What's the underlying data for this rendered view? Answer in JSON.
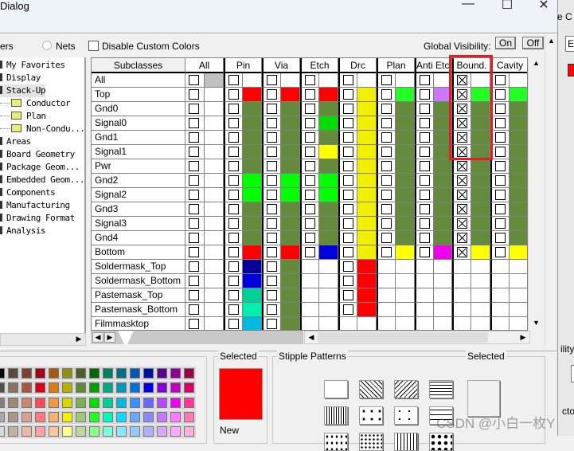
{
  "window": {
    "title": "Dialog",
    "minimize_icon": "minimize-icon",
    "maximize_icon": "maximize-icon",
    "close_icon": "close-icon"
  },
  "toolbar": {
    "layers_partial": "ers",
    "nets_label": "Nets",
    "disable_custom_colors_label": "Disable Custom Colors",
    "global_visibility_label": "Global Visibility:",
    "on_label": "On",
    "off_label": "Off"
  },
  "tree": {
    "items": [
      {
        "label": "My Favorites",
        "indent": 0
      },
      {
        "label": "Display",
        "indent": 0
      },
      {
        "label": "Stack-Up",
        "indent": 0,
        "selected": true
      },
      {
        "label": "Conductor",
        "indent": 1
      },
      {
        "label": "Plan",
        "indent": 1
      },
      {
        "label": "Non-Condu...",
        "indent": 1
      },
      {
        "label": "Areas",
        "indent": 0
      },
      {
        "label": "Board Geometry",
        "indent": 0
      },
      {
        "label": "Package Geom...",
        "indent": 0
      },
      {
        "label": "Embedded Geom...",
        "indent": 0
      },
      {
        "label": "Components",
        "indent": 0
      },
      {
        "label": "Manufacturing",
        "indent": 0
      },
      {
        "label": "Drawing Format",
        "indent": 0
      },
      {
        "label": "Analysis",
        "indent": 0
      }
    ]
  },
  "grid": {
    "subclasses_header": "Subclasses",
    "columns": [
      "All",
      "Pin",
      "Via",
      "Etch",
      "Drc",
      "Plan",
      "Anti Etch",
      "Bound.",
      "Cavity"
    ],
    "rows": [
      {
        "name": "All",
        "colors": [
          "#c0c0c0",
          null,
          null,
          null,
          null,
          null,
          null,
          null,
          null
        ],
        "checked": [
          false,
          false,
          false,
          false,
          false,
          false,
          false,
          true,
          false
        ]
      },
      {
        "name": "Top",
        "colors": [
          null,
          "#ff0000",
          "#ff0000",
          "#ff0000",
          "#f0f000",
          "#22ff22",
          "#cc77ff",
          "#22ff22",
          "#22ff22"
        ],
        "checked": [
          false,
          false,
          false,
          false,
          false,
          false,
          false,
          true,
          false
        ]
      },
      {
        "name": "Gnd0",
        "colors": [
          null,
          "#648a3c",
          "#648a3c",
          "#648a3c",
          "#f0f000",
          "#648a3c",
          "#648a3c",
          "#648a3c",
          "#648a3c"
        ],
        "checked": [
          false,
          false,
          false,
          false,
          false,
          false,
          false,
          true,
          false
        ]
      },
      {
        "name": "Signal0",
        "colors": [
          null,
          "#648a3c",
          "#648a3c",
          "#00dd00",
          "#f0f000",
          "#648a3c",
          "#648a3c",
          "#648a3c",
          "#648a3c"
        ],
        "checked": [
          false,
          false,
          false,
          false,
          false,
          false,
          false,
          true,
          false
        ]
      },
      {
        "name": "Gnd1",
        "colors": [
          null,
          "#648a3c",
          "#648a3c",
          "#648a3c",
          "#f0f000",
          "#648a3c",
          "#648a3c",
          "#648a3c",
          "#648a3c"
        ],
        "checked": [
          false,
          false,
          false,
          false,
          false,
          false,
          false,
          true,
          false
        ]
      },
      {
        "name": "Signal1",
        "colors": [
          null,
          "#648a3c",
          "#648a3c",
          "#ffff00",
          "#f0f000",
          "#648a3c",
          "#648a3c",
          "#648a3c",
          "#648a3c"
        ],
        "checked": [
          false,
          false,
          false,
          false,
          false,
          false,
          false,
          true,
          false
        ]
      },
      {
        "name": "Pwr",
        "colors": [
          null,
          "#648a3c",
          "#648a3c",
          "#648a3c",
          "#f0f000",
          "#648a3c",
          "#648a3c",
          "#648a3c",
          "#648a3c"
        ],
        "checked": [
          false,
          false,
          false,
          false,
          false,
          false,
          false,
          true,
          false
        ]
      },
      {
        "name": "Gnd2",
        "colors": [
          null,
          "#00ff00",
          "#00ff00",
          "#00ff00",
          "#f0f000",
          "#648a3c",
          "#648a3c",
          "#648a3c",
          "#648a3c"
        ],
        "checked": [
          false,
          false,
          false,
          false,
          false,
          false,
          false,
          true,
          false
        ]
      },
      {
        "name": "Signal2",
        "colors": [
          null,
          "#00ff00",
          "#00ff00",
          "#00ff00",
          "#f0f000",
          "#648a3c",
          "#648a3c",
          "#648a3c",
          "#648a3c"
        ],
        "checked": [
          false,
          false,
          false,
          false,
          false,
          false,
          false,
          true,
          false
        ]
      },
      {
        "name": "Gnd3",
        "colors": [
          null,
          "#648a3c",
          "#648a3c",
          "#648a3c",
          "#f0f000",
          "#648a3c",
          "#648a3c",
          "#648a3c",
          "#648a3c"
        ],
        "checked": [
          false,
          false,
          false,
          false,
          false,
          false,
          false,
          true,
          false
        ]
      },
      {
        "name": "Signal3",
        "colors": [
          null,
          "#648a3c",
          "#648a3c",
          "#648a3c",
          "#f0f000",
          "#648a3c",
          "#648a3c",
          "#648a3c",
          "#648a3c"
        ],
        "checked": [
          false,
          false,
          false,
          false,
          false,
          false,
          false,
          true,
          false
        ]
      },
      {
        "name": "Gnd4",
        "colors": [
          null,
          "#648a3c",
          "#648a3c",
          "#648a3c",
          "#f0f000",
          "#648a3c",
          "#648a3c",
          "#648a3c",
          "#648a3c"
        ],
        "checked": [
          false,
          false,
          false,
          false,
          false,
          false,
          false,
          true,
          false
        ]
      },
      {
        "name": "Bottom",
        "colors": [
          null,
          "#ff0000",
          "#ff0000",
          "#0000dd",
          "#f0f000",
          "#ffff00",
          "#ee00ee",
          "#ffff00",
          "#ffff00"
        ],
        "checked": [
          false,
          false,
          false,
          false,
          false,
          false,
          false,
          true,
          false
        ]
      },
      {
        "name": "Soldermask_Top",
        "colors": [
          null,
          "#000099",
          "#648a3c",
          "none",
          "#ff0000",
          "none",
          "none",
          "none",
          "none"
        ],
        "checked": [
          false,
          false,
          false,
          false,
          false,
          false,
          false,
          false,
          false
        ]
      },
      {
        "name": "Soldermask_Bottom",
        "colors": [
          null,
          "#0000dd",
          "#648a3c",
          "none",
          "#ff0000",
          "none",
          "none",
          "none",
          "none"
        ],
        "checked": [
          false,
          false,
          false,
          false,
          false,
          false,
          false,
          false,
          false
        ]
      },
      {
        "name": "Pastemask_Top",
        "colors": [
          null,
          "#00d098",
          "#648a3c",
          "none",
          "#ff0000",
          "none",
          "none",
          "none",
          "none"
        ],
        "checked": [
          false,
          false,
          false,
          false,
          false,
          false,
          false,
          false,
          false
        ]
      },
      {
        "name": "Pastemask_Bottom",
        "colors": [
          null,
          "#00f0b0",
          "#648a3c",
          "none",
          "#ff0000",
          "none",
          "none",
          "none",
          "none"
        ],
        "checked": [
          false,
          false,
          false,
          false,
          false,
          false,
          false,
          false,
          false
        ]
      },
      {
        "name": "Filmmasktop",
        "colors": [
          null,
          "#00bbe0",
          "#648a3c",
          "none",
          "none",
          "none",
          "none",
          "none",
          "none"
        ],
        "checked": [
          false,
          false,
          false,
          false,
          false,
          false,
          false,
          false,
          false
        ]
      }
    ]
  },
  "palette": {
    "rows": [
      [
        "#000000",
        "#5a4a3e",
        "#7a4030",
        "#a00018",
        "#a85810",
        "#909010",
        "#486028",
        "#006800",
        "#008060",
        "#007088",
        "#0058b0",
        "#0010a0",
        "#580090",
        "#900090",
        "#980048"
      ],
      [
        "#505050",
        "#8a7260",
        "#a85840",
        "#d80018",
        "#e07810",
        "#b8b000",
        "#608838",
        "#00a000",
        "#00a880",
        "#0098b8",
        "#0070e0",
        "#0000e8",
        "#8800d8",
        "#c000c0",
        "#d80068"
      ],
      [
        "#808080",
        "#a08878",
        "#c88870",
        "#ff4858",
        "#f09840",
        "#d8d800",
        "#80b050",
        "#00e000",
        "#00d098",
        "#00b8e0",
        "#3890ff",
        "#6868ff",
        "#b848ff",
        "#f000f0",
        "#ff3898"
      ],
      [
        "#a8a8a8",
        "#a89888",
        "#d8a090",
        "#ff7880",
        "#f8b070",
        "#f0f000",
        "#a0c878",
        "#20ff20",
        "#00f8b8",
        "#10d8ff",
        "#68a8ff",
        "#8888ff",
        "#c878ff",
        "#ff78ff",
        "#ff78b8"
      ],
      [
        "#d8d8d8",
        "#c0b0a0",
        "#e8b8a8",
        "#ffa0a8",
        "#f8c898",
        "#ffff88",
        "#c0d8a0",
        "#88ff88",
        "#78ffd8",
        "#88e8ff",
        "#98c8ff",
        "#b0b0ff",
        "#d8a8ff",
        "#ffa8ff",
        "#ffb0d8"
      ]
    ]
  },
  "selected_color": {
    "label": "Selected",
    "color": "#ff0000",
    "new_label": "New"
  },
  "stipple": {
    "label": "Stipple Patterns",
    "selected_label": "Selected",
    "patterns": [
      "solid",
      "diag-down",
      "diag-up",
      "horizontal",
      "vertical",
      "triangles",
      "crosses",
      "dashes",
      "dots-1",
      "xxx",
      "comb",
      "dots-2"
    ]
  },
  "side_window": {
    "field_text": "E",
    "partial_1": "e C",
    "partial_2": "ility",
    "partial_3": "cto",
    "swatch_color": "#ff0000"
  },
  "watermark": "CSDN @小白一枚Y"
}
